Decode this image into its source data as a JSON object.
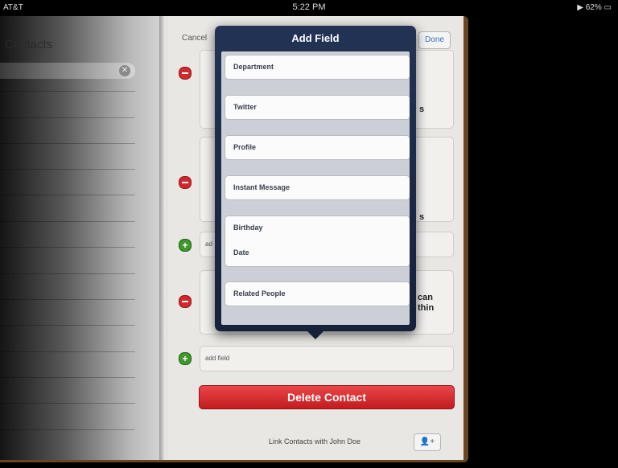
{
  "status_bar": {
    "carrier": "AT&T",
    "time": "5:22 PM",
    "battery": "62%"
  },
  "left_page": {
    "title": "Contacts"
  },
  "edit_header": {
    "cancel": "Cancel",
    "done": "Done"
  },
  "popover": {
    "title": "Add Field",
    "items": [
      "Department",
      "Twitter",
      "Profile",
      "Instant Message",
      "Birthday",
      "Date",
      "Related People"
    ]
  },
  "behind": {
    "add_field_label": "add field",
    "partial_add": "ad",
    "peek_1": "can",
    "peek_2": "thin",
    "peek_3": "s",
    "peek_4": "s"
  },
  "delete_button": "Delete Contact",
  "link_contacts": "Link Contacts with John Doe"
}
